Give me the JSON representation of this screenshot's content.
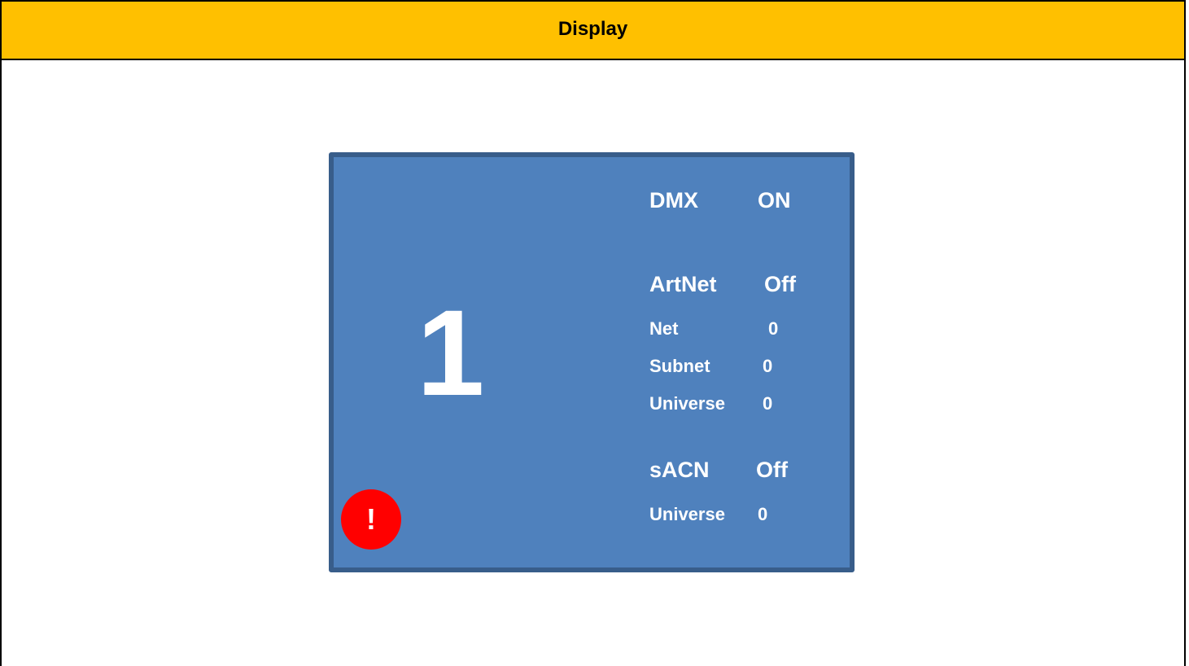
{
  "header": {
    "title": "Display"
  },
  "display": {
    "channel_number": "1",
    "alert_symbol": "!",
    "dmx": {
      "label": "DMX",
      "value": "ON"
    },
    "artnet": {
      "label": "ArtNet",
      "value": "Off",
      "net": {
        "label": "Net",
        "value": "0"
      },
      "subnet": {
        "label": "Subnet",
        "value": "0"
      },
      "universe": {
        "label": "Universe",
        "value": "0"
      }
    },
    "sacn": {
      "label": "sACN",
      "value": "Off",
      "universe": {
        "label": "Universe",
        "value": "0"
      }
    }
  },
  "colors": {
    "header_bg": "#ffc000",
    "panel_bg": "#4f81bd",
    "panel_border": "#385d8a",
    "alert_bg": "#ff0000",
    "text_on_panel": "#ffffff"
  },
  "icons": {
    "alert": "exclamation-icon"
  }
}
